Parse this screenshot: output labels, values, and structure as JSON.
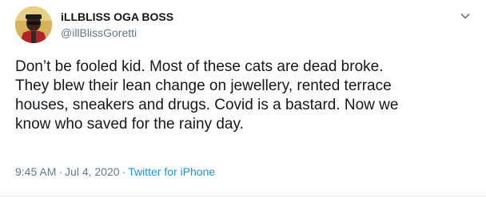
{
  "user": {
    "display_name": "iLLBLISS OGA BOSS",
    "handle": "@illBlissGoretti"
  },
  "tweet": {
    "text": "Don’t be fooled kid. Most of these cats are dead broke.\nThey blew their lean change on jewellery, rented terrace\nhouses, sneakers and drugs. Covid is a bastard. Now we\nknow who saved for the rainy day."
  },
  "meta": {
    "time": "9:45 AM",
    "separator": "·",
    "date": "Jul 4, 2020",
    "source": "Twitter for iPhone"
  },
  "icons": {
    "menu": "chevron-down-icon"
  },
  "colors": {
    "text": "#14171a",
    "secondary": "#657786",
    "link": "#1b95e0",
    "divider": "#e6ecf0"
  }
}
